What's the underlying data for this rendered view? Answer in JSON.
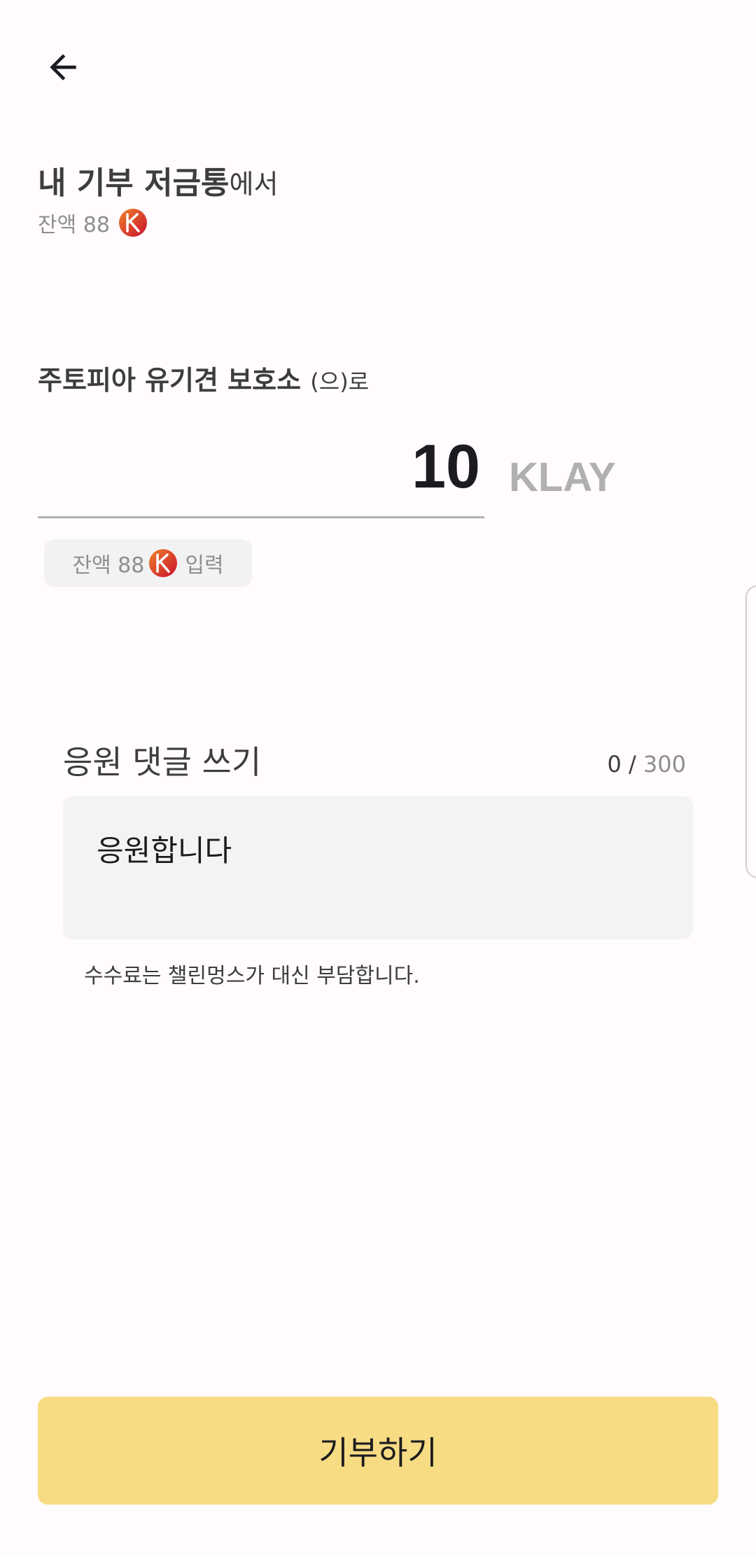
{
  "header": {
    "back_icon": "arrow-left-icon"
  },
  "source": {
    "name": "내 기부 저금통",
    "suffix": "에서",
    "balance_label": "잔액 88",
    "coin_icon": "klay-coin-icon"
  },
  "destination": {
    "name": "주토피아 유기견 보호소",
    "suffix": "(으)로"
  },
  "amount": {
    "value": "10",
    "unit": "KLAY"
  },
  "balance_chip": {
    "balance_label": "잔액 88",
    "action_label": "입력"
  },
  "comment": {
    "title": "응원 댓글 쓰기",
    "count": "0",
    "separator": " / ",
    "max": "300",
    "value": "응원합니다"
  },
  "fee_notice": "수수료는 챌린멍스가 대신 부담합니다.",
  "donate_button": {
    "label": "기부하기"
  },
  "colors": {
    "background": "#fffbfe",
    "button": "#f7dc84",
    "input_bg": "#f2f3f2",
    "coin_red": "#d6213a",
    "coin_orange": "#f0802a"
  }
}
